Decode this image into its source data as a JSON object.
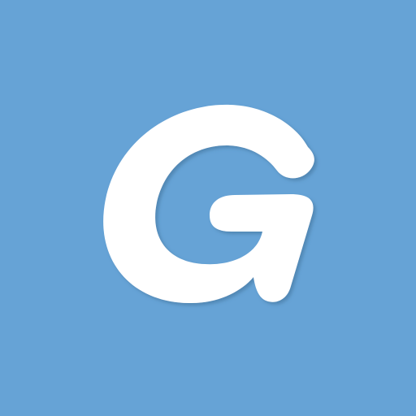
{
  "icon": {
    "name": "g-logo-icon",
    "letter": "G"
  },
  "colors": {
    "background": "#66a3d6",
    "glyph": "#ffffff",
    "shadow": "#3f6f99"
  }
}
